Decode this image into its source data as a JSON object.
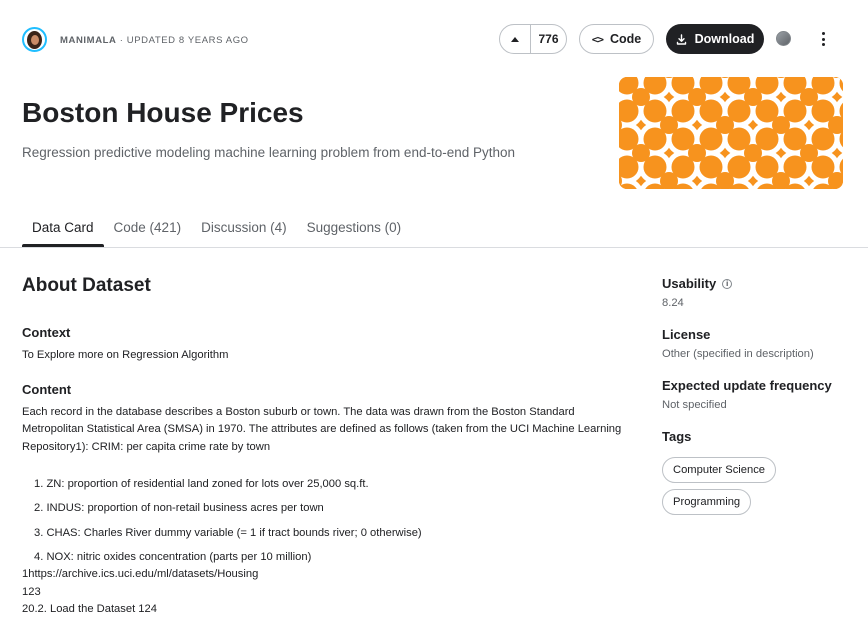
{
  "header": {
    "author": "MANIMALA",
    "updated": " · UPDATED 8 YEARS AGO",
    "vote_count": "776",
    "code_label": "Code",
    "download_label": "Download"
  },
  "dataset": {
    "title": "Boston House Prices",
    "subtitle": "Regression predictive modeling machine learning problem from end-to-end Python",
    "cover_color": "#f7931e"
  },
  "tabs": [
    {
      "label": "Data Card",
      "active": true
    },
    {
      "label": "Code (421)"
    },
    {
      "label": "Discussion (4)"
    },
    {
      "label": "Suggestions (0)"
    }
  ],
  "about": {
    "heading": "About Dataset",
    "context_heading": "Context",
    "context_text": "To Explore more on Regression Algorithm",
    "content_heading": "Content",
    "content_text": "Each record in the database describes a Boston suburb or town. The data was drawn from the Boston Standard Metropolitan Statistical Area (SMSA) in 1970. The attributes are defined as follows (taken from the UCI Machine Learning Repository1): CRIM: per capita crime rate by town",
    "list": [
      "1. ZN: proportion of residential land zoned for lots over 25,000 sq.ft.",
      "2. INDUS: proportion of non-retail business acres per town",
      "3. CHAS: Charles River dummy variable (= 1 if tract bounds river; 0 otherwise)",
      "4. NOX: nitric oxides concentration (parts per 10 million)"
    ],
    "trailing": [
      "1https://archive.ics.uci.edu/ml/datasets/Housing",
      "123",
      "20.2. Load the Dataset 124"
    ]
  },
  "sidebar": {
    "usability_label": "Usability",
    "usability_value": "8.24",
    "license_label": "License",
    "license_value": "Other (specified in description)",
    "frequency_label": "Expected update frequency",
    "frequency_value": "Not specified",
    "tags_label": "Tags",
    "tags": [
      "Computer Science",
      "Programming"
    ]
  }
}
